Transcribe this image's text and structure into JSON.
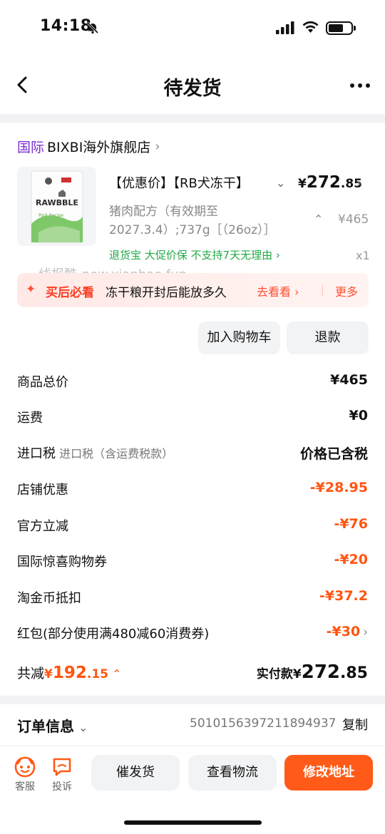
{
  "status_bar": {
    "time": "14:18"
  },
  "nav": {
    "title": "待发货"
  },
  "shop": {
    "tag": "国际",
    "name": "BIXBI海外旗舰店",
    "chev": "›"
  },
  "product": {
    "brand_on_pack": "RAWBBLE",
    "pack_text": "Pork Recipe",
    "name": "【优惠价】【RB犬冻干】",
    "price_symbol": "¥",
    "price_int": "272",
    "price_dec": ".85",
    "spec": "猪肉配方（有效期至2027.3.4）;737g［（26oz）］",
    "original_price": "¥465",
    "guarantee": "退货宝  大促价保  不支持7天无理由 ›",
    "qty": "x1"
  },
  "watermark": "线报酷-new.xianbao.fun",
  "tip": {
    "label": "买后必看",
    "question": "冻干粮开封后能放多久",
    "go": "去看看 ›",
    "more": "更多"
  },
  "actions": {
    "add_cart": "加入购物车",
    "refund": "退款"
  },
  "price_rows": [
    {
      "key": "商品总价",
      "sub": "",
      "value": "¥465",
      "red": false
    },
    {
      "key": "运费",
      "sub": "",
      "value": "¥0",
      "red": false
    },
    {
      "key": "进口税",
      "sub": " 进口税（含运费税款）",
      "value": "价格已含税",
      "red": false
    },
    {
      "key": "店铺优惠",
      "sub": "",
      "value": "-¥28.95",
      "red": true
    },
    {
      "key": "官方立减",
      "sub": "",
      "value": "-¥76",
      "red": true
    },
    {
      "key": "国际惊喜购物券",
      "sub": "",
      "value": "-¥20",
      "red": true
    },
    {
      "key": "淘金币抵扣",
      "sub": "",
      "value": "-¥37.2",
      "red": true
    },
    {
      "key": "红包(部分使用满480减60消费券)",
      "sub": "",
      "value": "-¥30",
      "red": true
    }
  ],
  "total": {
    "saved_label": "共减",
    "saved_symbol": "¥",
    "saved_int": "192",
    "saved_dec": ".15",
    "paid_label": "实付款",
    "paid_symbol": "¥",
    "paid_int": "272",
    "paid_dec": ".85"
  },
  "order": {
    "title": "订单信息",
    "number": "5010156397211894937",
    "copy": "复制"
  },
  "bottom_bar": {
    "service": "客服",
    "complaint": "投诉",
    "urge": "催发货",
    "logistics": "查看物流",
    "modify_address": "修改地址"
  },
  "colors": {
    "accent": "#ff5a17",
    "discount": "#ff5511",
    "guarantee_green": "#23a847",
    "intl_purple": "#7b2fd0"
  }
}
